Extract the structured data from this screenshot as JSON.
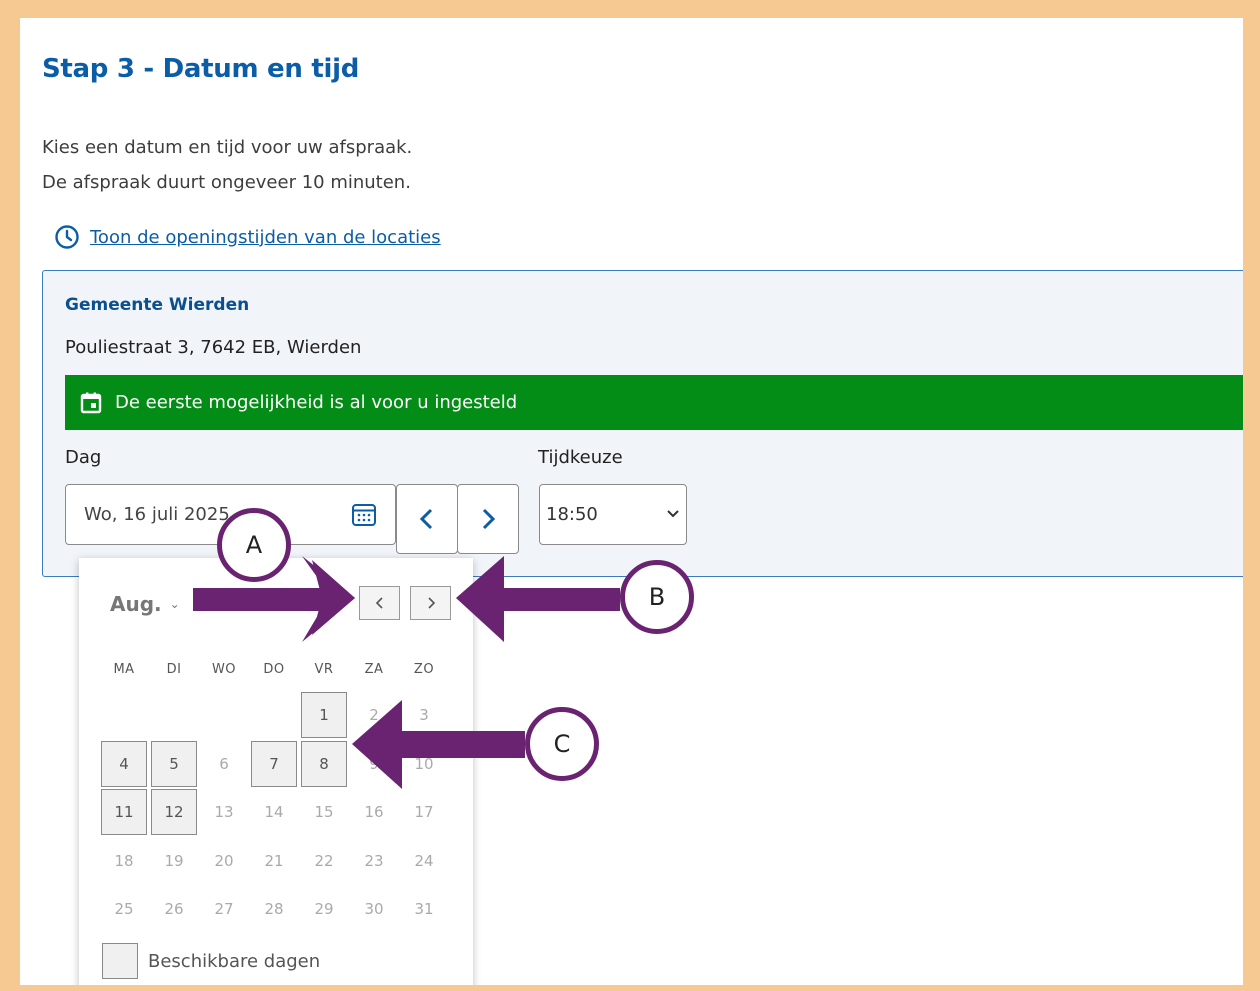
{
  "page": {
    "title": "Stap 3 - Datum en tijd",
    "intro_line1": "Kies een datum en tijd voor uw afspraak.",
    "intro_line2": "De afspraak duurt ongeveer 10 minuten.",
    "hours_link": "Toon de openingstijden van de locaties"
  },
  "location": {
    "name": "Gemeente Wierden",
    "address": "Pouliestraat 3, 7642 EB, Wierden",
    "banner": "De eerste mogelijkheid is al voor u ingesteld",
    "day_label": "Dag",
    "day_value": "Wo, 16 juli 2025",
    "time_label": "Tijdkeuze",
    "time_value": "18:50"
  },
  "calendar": {
    "month": "Aug.",
    "weekdays": [
      "MA",
      "DI",
      "WO",
      "DO",
      "VR",
      "ZA",
      "ZO"
    ],
    "first_weekday_index": 4,
    "days_in_month": 31,
    "available_days": [
      1,
      4,
      5,
      7,
      8,
      11,
      12
    ],
    "legend": "Beschikbare dagen"
  },
  "annotations": {
    "a": "A",
    "b": "B",
    "c": "C",
    "color": "#6a2370"
  },
  "colors": {
    "border": "#f6c892",
    "primary": "#0b5da8",
    "banner": "#048d16"
  }
}
